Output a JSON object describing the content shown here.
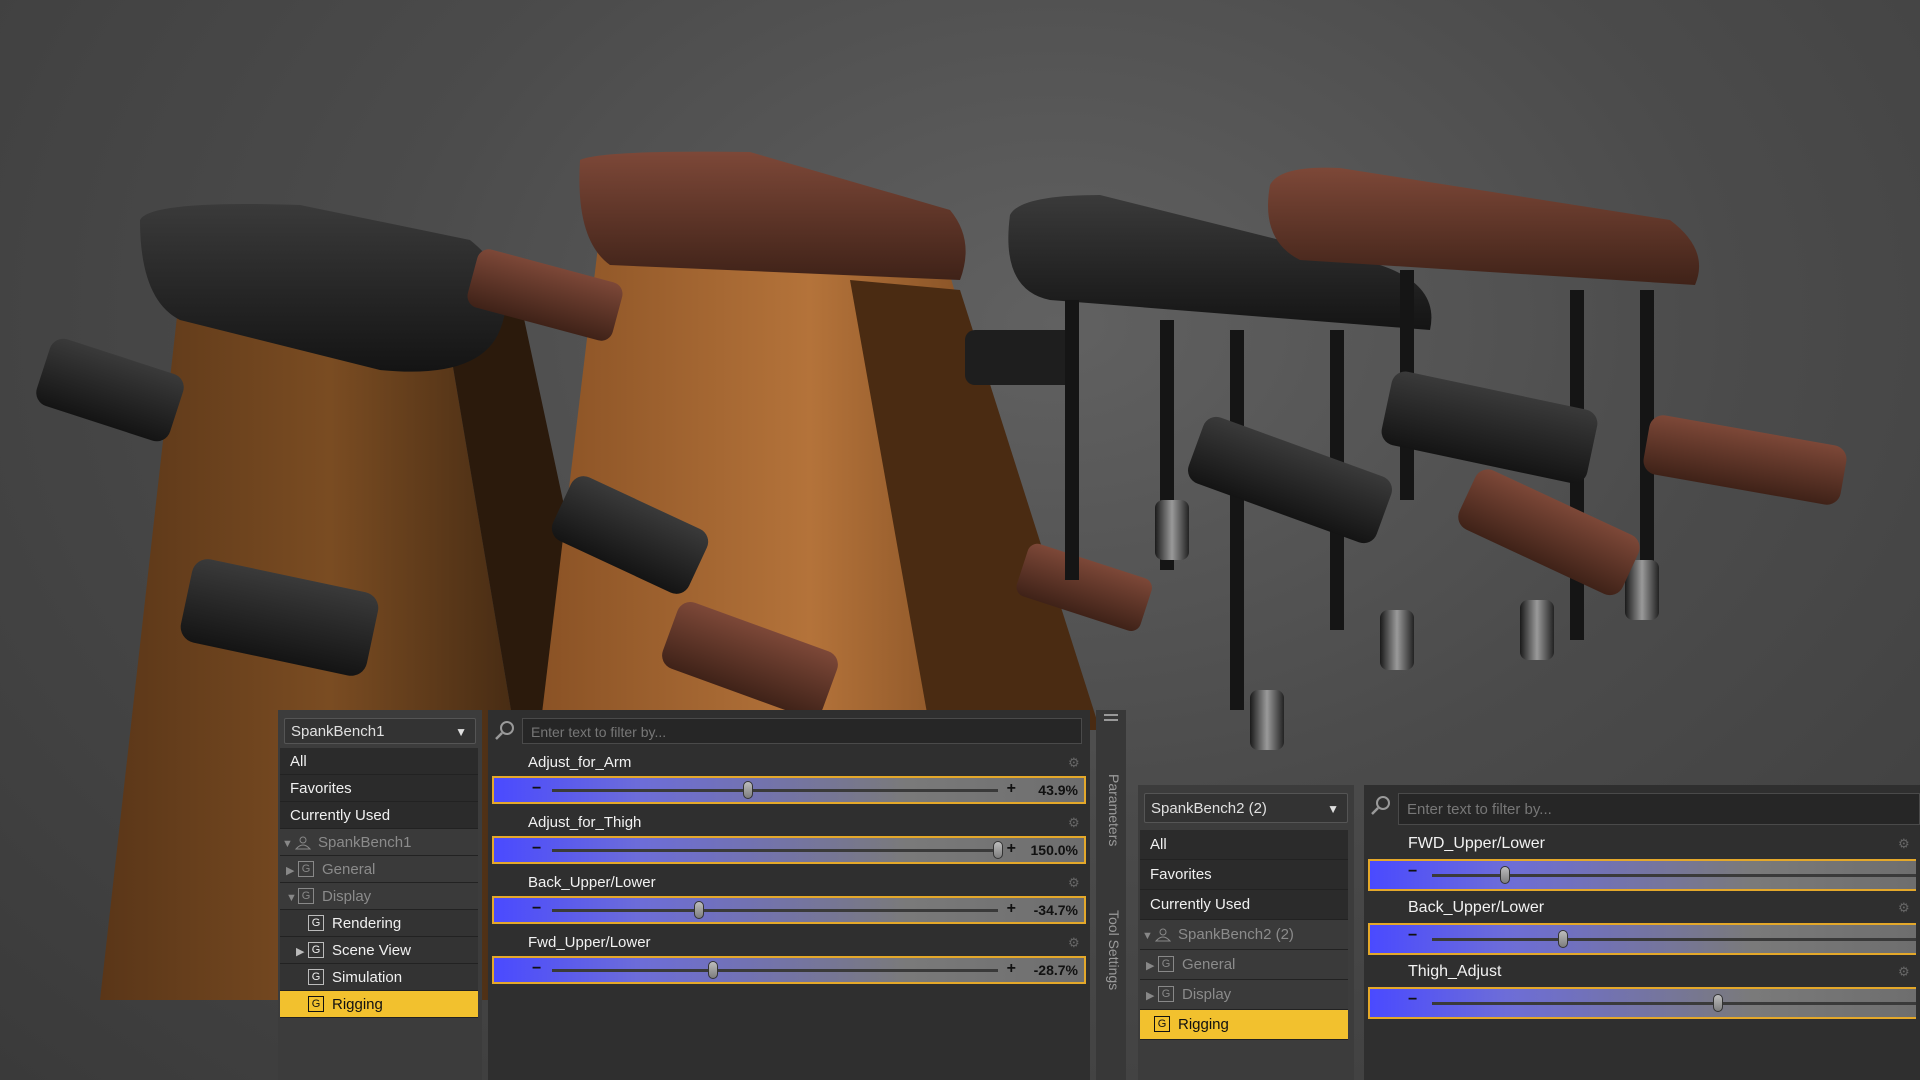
{
  "panels": [
    {
      "dropdown": "SpankBench1",
      "tree": [
        {
          "label": "All",
          "kind": "top"
        },
        {
          "label": "Favorites",
          "kind": "top"
        },
        {
          "label": "Currently Used",
          "kind": "top"
        },
        {
          "label": "SpankBench1",
          "kind": "node",
          "toggle": "▼",
          "icon": "figure-icon"
        },
        {
          "label": "General",
          "kind": "node",
          "toggle": "▶",
          "icon": "group-icon"
        },
        {
          "label": "Display",
          "kind": "node",
          "toggle": "▼",
          "icon": "group-icon"
        },
        {
          "label": "Rendering",
          "kind": "sub",
          "toggle": "",
          "icon": "group-icon"
        },
        {
          "label": "Scene View",
          "kind": "sub",
          "toggle": "▶",
          "icon": "group-icon"
        },
        {
          "label": "Simulation",
          "kind": "sub",
          "toggle": "",
          "icon": "group-icon"
        },
        {
          "label": "Rigging",
          "kind": "selected",
          "toggle": "",
          "icon": "group-icon"
        }
      ],
      "search_placeholder": "Enter text to filter by...",
      "params": [
        {
          "label": "Adjust_for_Arm",
          "value": "43.9%",
          "level": 0.44
        },
        {
          "label": "Adjust_for_Thigh",
          "value": "150.0%",
          "level": 1.0
        },
        {
          "label": "Back_Upper/Lower",
          "value": "-34.7%",
          "level": 0.33
        },
        {
          "label": "Fwd_Upper/Lower",
          "value": "-28.7%",
          "level": 0.36
        }
      ],
      "side_tabs": [
        "Parameters",
        "Tool Settings"
      ]
    },
    {
      "dropdown": "SpankBench2 (2)",
      "tree": [
        {
          "label": "All",
          "kind": "top"
        },
        {
          "label": "Favorites",
          "kind": "top"
        },
        {
          "label": "Currently Used",
          "kind": "top"
        },
        {
          "label": "SpankBench2 (2)",
          "kind": "node",
          "toggle": "▼",
          "icon": "figure-icon"
        },
        {
          "label": "General",
          "kind": "node",
          "toggle": "▶",
          "icon": "group-icon"
        },
        {
          "label": "Display",
          "kind": "node",
          "toggle": "▶",
          "icon": "group-icon"
        },
        {
          "label": "Rigging",
          "kind": "selected",
          "toggle": "",
          "icon": "group-icon"
        }
      ],
      "search_placeholder": "Enter text to filter by...",
      "params": [
        {
          "label": "FWD_Upper/Lower",
          "value": "",
          "level": 0.15
        },
        {
          "label": "Back_Upper/Lower",
          "value": "",
          "level": 0.27
        },
        {
          "label": "Thigh_Adjust",
          "value": "",
          "level": 0.59
        }
      ]
    }
  ],
  "group_glyph": "G"
}
